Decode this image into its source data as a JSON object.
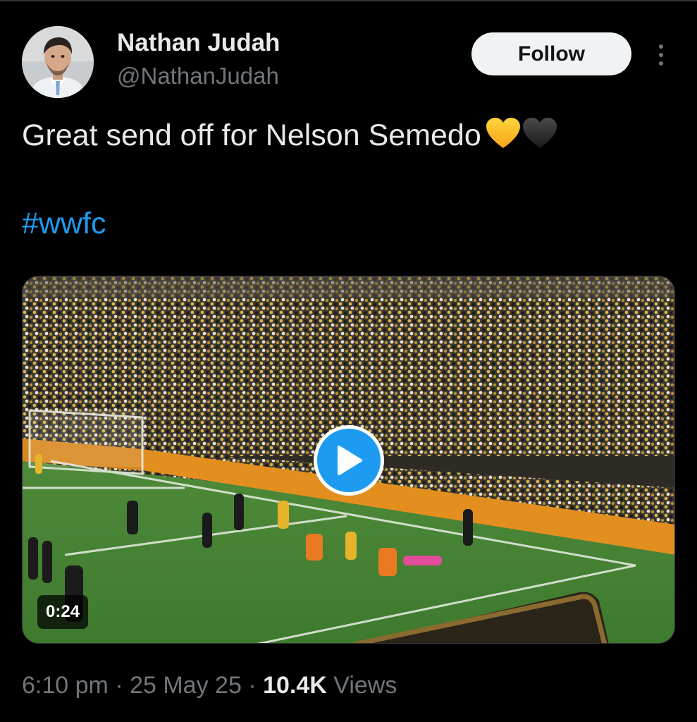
{
  "author": {
    "display_name": "Nathan Judah",
    "handle": "@NathanJudah",
    "avatar_icon": "profile-photo"
  },
  "actions": {
    "follow_label": "Follow",
    "more_icon": "more-vertical-icon"
  },
  "tweet": {
    "text": "Great send off for Nelson Semedo",
    "emojis": [
      "yellow-heart",
      "black-heart"
    ],
    "hashtag": "#wwfc"
  },
  "media": {
    "type": "video",
    "duration": "0:24",
    "play_icon": "play-icon"
  },
  "meta": {
    "time": "6:10 pm",
    "separator": "·",
    "date": "25 May 25",
    "views_count": "10.4K",
    "views_label": "Views"
  },
  "colors": {
    "background": "#000000",
    "text": "#e7e9ea",
    "secondary": "#71767b",
    "link": "#1d9bf0",
    "follow_bg": "#eff3f4"
  }
}
